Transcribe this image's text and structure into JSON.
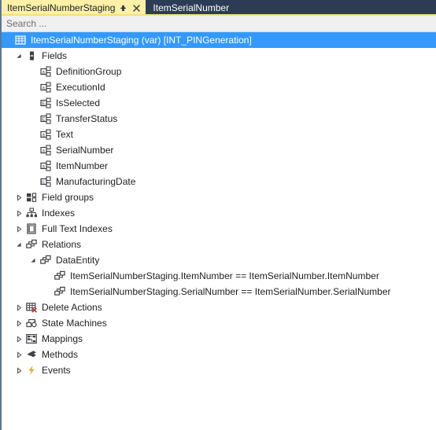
{
  "tabs": [
    {
      "label": "ItemSerialNumberStaging",
      "active": true,
      "pin_icon": "pin-icon",
      "close_icon": "close-icon"
    },
    {
      "label": "ItemSerialNumber",
      "active": false
    }
  ],
  "search": {
    "placeholder": "Search ...",
    "value": ""
  },
  "colors": {
    "tab_active_bg": "#fdf1a8",
    "tabstrip_bg": "#2d3c56",
    "selection_bg": "#3399ff",
    "search_bg": "#f0f0f0",
    "events_icon": "#e8a33d",
    "delete_icon_accent": "#c0392b"
  },
  "tree": [
    {
      "label": "ItemSerialNumberStaging (var) [INT_PINGeneration]",
      "indent": 0,
      "icon": "table-icon",
      "expander": "none",
      "selected": true
    },
    {
      "label": "Fields",
      "indent": 1,
      "icon": "fields-icon",
      "expander": "expanded",
      "selected": false
    },
    {
      "label": "DefinitionGroup",
      "indent": 2,
      "icon": "field-string-icon",
      "expander": "none",
      "selected": false
    },
    {
      "label": "ExecutionId",
      "indent": 2,
      "icon": "field-string-icon",
      "expander": "none",
      "selected": false
    },
    {
      "label": "IsSelected",
      "indent": 2,
      "icon": "field-enum-icon",
      "expander": "none",
      "selected": false
    },
    {
      "label": "TransferStatus",
      "indent": 2,
      "icon": "field-enum-icon",
      "expander": "none",
      "selected": false
    },
    {
      "label": "Text",
      "indent": 2,
      "icon": "field-string-icon",
      "expander": "none",
      "selected": false
    },
    {
      "label": "SerialNumber",
      "indent": 2,
      "icon": "field-string-icon",
      "expander": "none",
      "selected": false
    },
    {
      "label": "ItemNumber",
      "indent": 2,
      "icon": "field-string-icon",
      "expander": "none",
      "selected": false
    },
    {
      "label": "ManufacturingDate",
      "indent": 2,
      "icon": "field-date-icon",
      "expander": "none",
      "selected": false
    },
    {
      "label": "Field groups",
      "indent": 1,
      "icon": "field-groups-icon",
      "expander": "collapsed",
      "selected": false
    },
    {
      "label": "Indexes",
      "indent": 1,
      "icon": "indexes-icon",
      "expander": "collapsed",
      "selected": false
    },
    {
      "label": "Full Text Indexes",
      "indent": 1,
      "icon": "full-text-indexes-icon",
      "expander": "collapsed",
      "selected": false
    },
    {
      "label": "Relations",
      "indent": 1,
      "icon": "relations-icon",
      "expander": "expanded",
      "selected": false
    },
    {
      "label": "DataEntity",
      "indent": 2,
      "icon": "relations-icon",
      "expander": "expanded",
      "selected": false
    },
    {
      "label": "ItemSerialNumberStaging.ItemNumber == ItemSerialNumber.ItemNumber",
      "indent": 3,
      "icon": "relations-icon",
      "expander": "none",
      "selected": false
    },
    {
      "label": "ItemSerialNumberStaging.SerialNumber == ItemSerialNumber.SerialNumber",
      "indent": 3,
      "icon": "relations-icon",
      "expander": "none",
      "selected": false
    },
    {
      "label": "Delete Actions",
      "indent": 1,
      "icon": "delete-actions-icon",
      "expander": "collapsed",
      "selected": false
    },
    {
      "label": "State Machines",
      "indent": 1,
      "icon": "state-machines-icon",
      "expander": "collapsed",
      "selected": false
    },
    {
      "label": "Mappings",
      "indent": 1,
      "icon": "mappings-icon",
      "expander": "collapsed",
      "selected": false
    },
    {
      "label": "Methods",
      "indent": 1,
      "icon": "methods-icon",
      "expander": "collapsed",
      "selected": false
    },
    {
      "label": "Events",
      "indent": 1,
      "icon": "events-icon",
      "expander": "collapsed",
      "selected": false
    }
  ]
}
